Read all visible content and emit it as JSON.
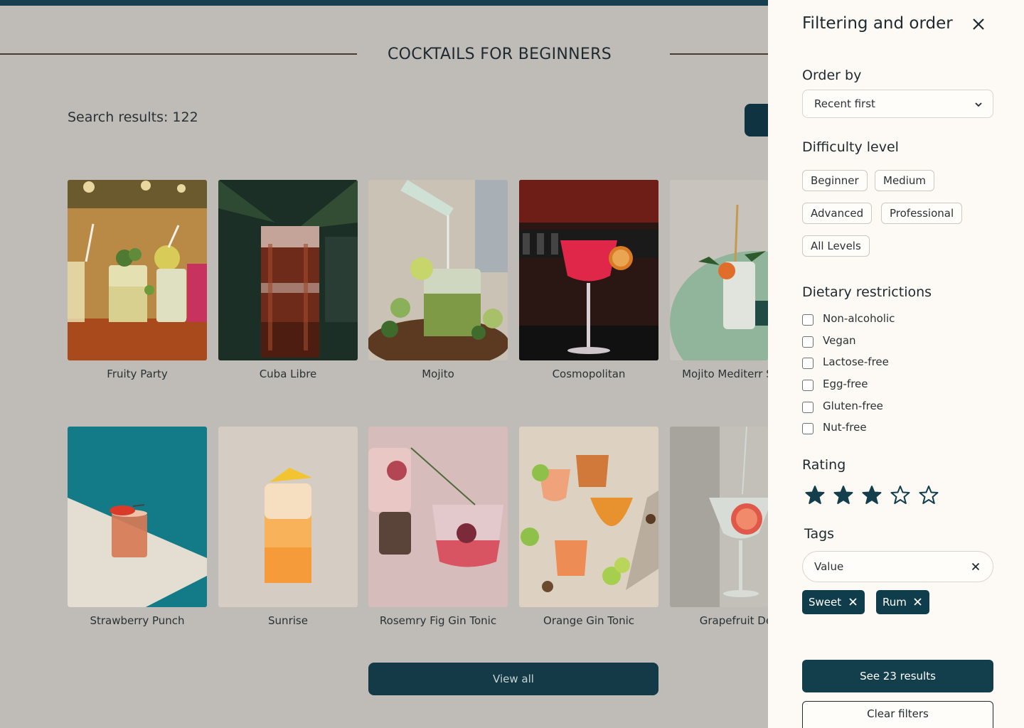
{
  "page": {
    "title": "COCKTAILS FOR BEGINNERS",
    "results_label": "Search results: 122",
    "view_all_label": "View all"
  },
  "cocktails": [
    {
      "name": "Fruity Party",
      "image": "fruity-party-photo"
    },
    {
      "name": "Cuba Libre",
      "image": "cuba-libre-photo"
    },
    {
      "name": "Mojito",
      "image": "mojito-photo"
    },
    {
      "name": "Cosmopolitan",
      "image": "cosmopolitan-photo"
    },
    {
      "name": "Mojito Mediterr Style",
      "image": "mojito-mediterranean-photo"
    },
    {
      "name": "Strawberry Punch",
      "image": "strawberry-punch-photo"
    },
    {
      "name": "Sunrise",
      "image": "sunrise-photo"
    },
    {
      "name": "Rosemry Fig Gin Tonic",
      "image": "rosemary-fig-gin-tonic-photo"
    },
    {
      "name": "Orange Gin Tonic",
      "image": "orange-gin-tonic-photo"
    },
    {
      "name": "Grapefruit Del",
      "image": "grapefruit-photo"
    }
  ],
  "drawer": {
    "title": "Filtering and order",
    "order_by": {
      "label": "Order by",
      "selected": "Recent first"
    },
    "difficulty": {
      "label": "Difficulty level",
      "options": [
        "Beginner",
        "Medium",
        "Advanced",
        "Professional",
        "All Levels"
      ]
    },
    "dietary": {
      "label": "Dietary restrictions",
      "options": [
        {
          "label": "Non-alcoholic",
          "checked": false
        },
        {
          "label": "Vegan",
          "checked": false
        },
        {
          "label": "Lactose-free",
          "checked": false
        },
        {
          "label": "Egg-free",
          "checked": false
        },
        {
          "label": "Gluten-free",
          "checked": false
        },
        {
          "label": "Nut-free",
          "checked": false
        }
      ]
    },
    "rating": {
      "label": "Rating",
      "value": 3,
      "max": 5
    },
    "tags": {
      "label": "Tags",
      "input_value": "Value",
      "selected": [
        "Sweet",
        "Rum"
      ]
    },
    "see_results_label": "See 23 results",
    "clear_label": "Clear filters"
  },
  "colors": {
    "primary": "#133f4d",
    "overlay_bg": "#bfbbb6",
    "drawer_bg": "#fdf9f4"
  }
}
